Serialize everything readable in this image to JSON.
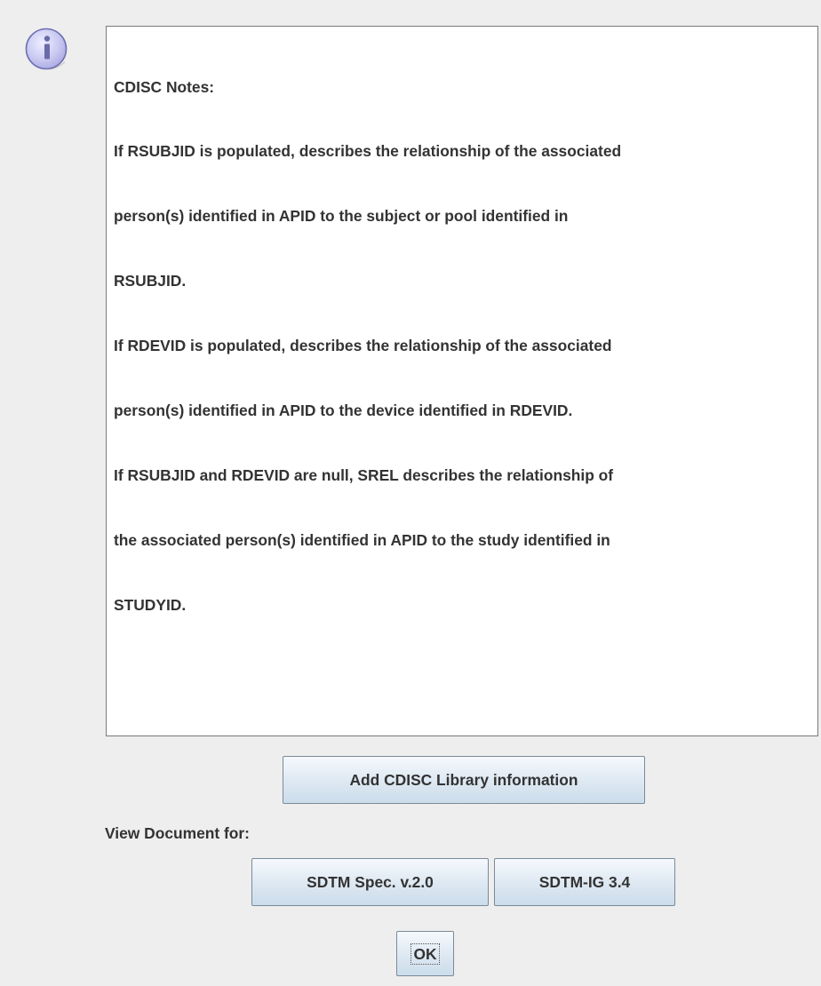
{
  "dialog": {
    "icon": "info-icon",
    "notes": {
      "lines": [
        "CDISC Notes:",
        "If RSUBJID is populated, describes the relationship of the associated",
        "person(s) identified in APID to the subject or pool identified in",
        "RSUBJID.",
        "If RDEVID is populated, describes the relationship of the associated",
        "person(s) identified in APID to the device identified in RDEVID.",
        "If RSUBJID and RDEVID are null, SREL describes the relationship of",
        "the associated person(s) identified in APID to the study identified in",
        "STUDYID."
      ]
    },
    "add_library_button": "Add CDISC Library information",
    "view_document_label": "View Document for:",
    "doc_buttons": {
      "sdtm_spec": "SDTM Spec. v.2.0",
      "sdtm_ig": "SDTM-IG 3.4"
    },
    "ok_button": "OK",
    "colors": {
      "background": "#eeeeee",
      "icon_fill": "#c9c9f2",
      "icon_border": "#6f6fb4",
      "button_border": "#7a8a99"
    }
  }
}
